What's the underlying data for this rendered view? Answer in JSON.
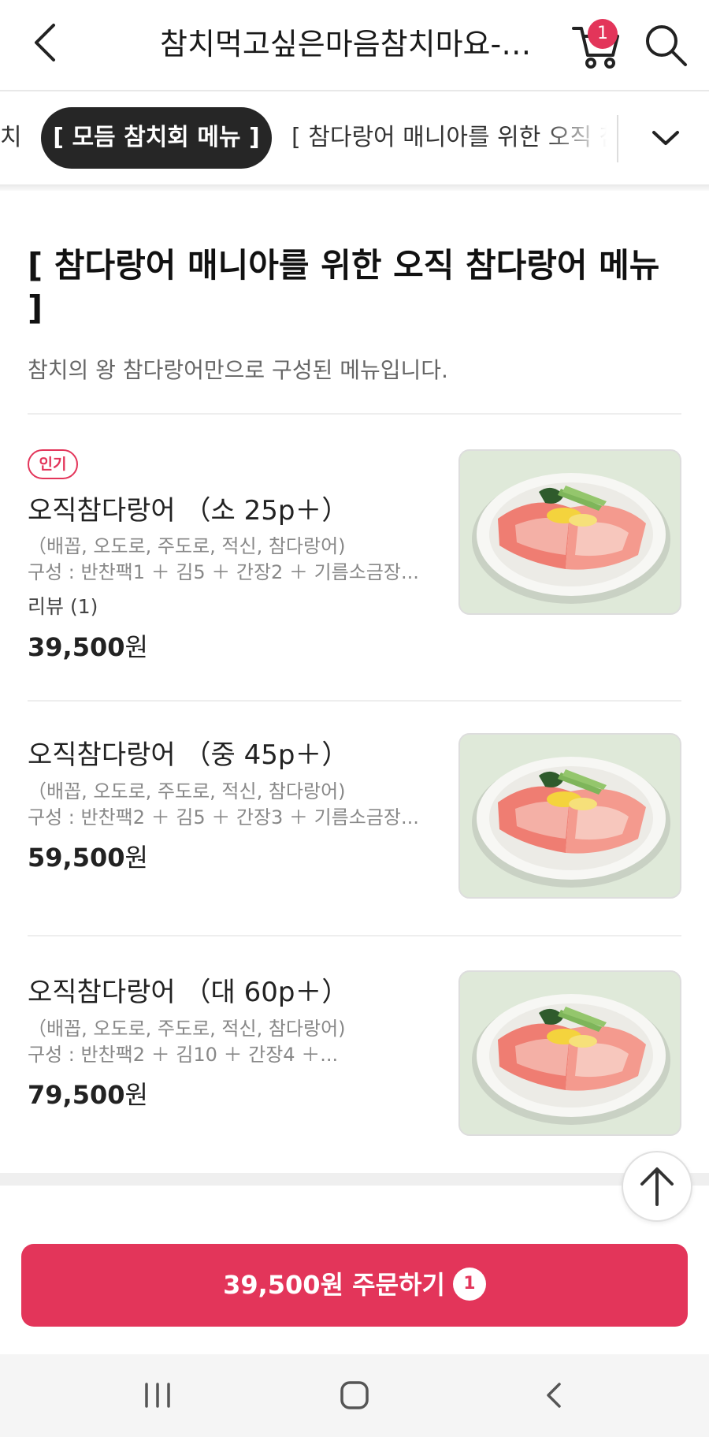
{
  "header": {
    "title": "참치먹고싶은마음참치마요-오...",
    "cart_count": "1"
  },
  "tabs": {
    "prev_label": "치",
    "active_label": "[ 모듬 참치회 메뉴 ]",
    "next_label": "[ 참다랑어 매니아를 위한 오직 참다랑어 메뉴 ]"
  },
  "section": {
    "title": "[ 참다랑어 매니아를 위한 오직 참다랑어 메뉴 ]",
    "description": "참치의 왕 참다랑어만으로 구성된 메뉴입니다."
  },
  "menu": {
    "items": [
      {
        "badge": "인기",
        "name": "오직참다랑어 （소 25p＋）",
        "parts": "（배꼽, 오도로, 주도로, 적신, 참다랑어)",
        "composition": "구성 : 반찬팩1 ＋ 김5 ＋ 간장2 ＋ 기름소금장...",
        "review": "리뷰 (1)",
        "price_num": "39,500",
        "price_unit": "원"
      },
      {
        "name": "오직참다랑어 （중 45p＋）",
        "parts": "（배꼽, 오도로, 주도로, 적신, 참다랑어)",
        "composition": "구성 : 반찬팩2 ＋ 김5 ＋ 간장3 ＋ 기름소금장...",
        "price_num": "59,500",
        "price_unit": "원"
      },
      {
        "name": "오직참다랑어 （대 60p＋）",
        "parts": "（배꼽, 오도로, 주도로, 적신, 참다랑어)",
        "composition": "구성 : 반찬팩2 ＋ 김10 ＋ 간장4 ＋...",
        "price_num": "79,500",
        "price_unit": "원"
      }
    ]
  },
  "order": {
    "label": "39,500원 주문하기",
    "count": "1"
  },
  "colors": {
    "accent": "#e3355a",
    "active_tab": "#262626"
  },
  "icons": {
    "back": "chevron-left-icon",
    "cart": "cart-icon",
    "search": "search-icon",
    "expand": "chevron-down-icon",
    "scroll_top": "arrow-up-icon",
    "nav_recents": "recents-icon",
    "nav_home": "home-icon",
    "nav_back": "back-icon"
  }
}
